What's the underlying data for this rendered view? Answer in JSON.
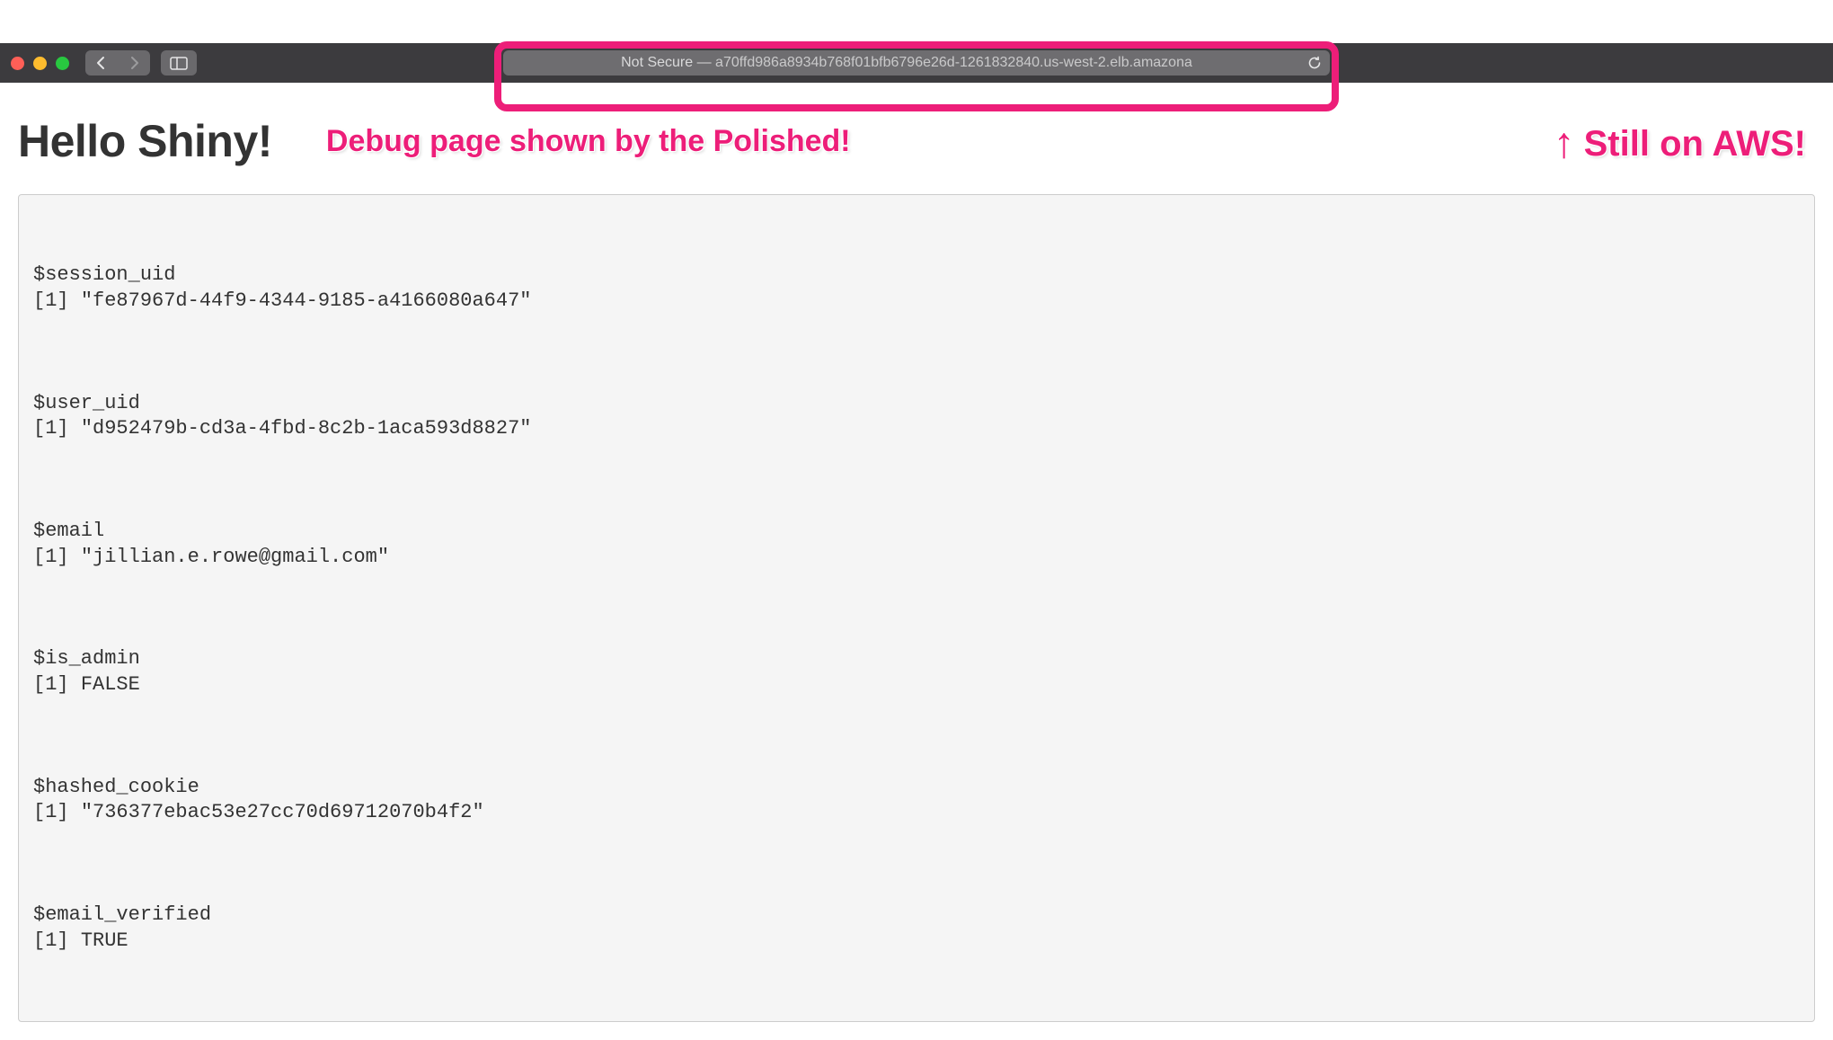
{
  "toolbar": {
    "address_prefix": "Not Secure — ",
    "address_url": "a70ffd986a8934b768f01bfb6796e26d-1261832840.us-west-2.elb.amazona"
  },
  "page": {
    "title": "Hello Shiny!"
  },
  "annotations": {
    "debug_note": "Debug page shown by the Polished!",
    "aws_note": "Still on AWS!",
    "arrow": "↑"
  },
  "debug": {
    "session_uid": {
      "label": "$session_uid",
      "index": "[1]",
      "value": "\"fe87967d-44f9-4344-9185-a4166080a647\""
    },
    "user_uid": {
      "label": "$user_uid",
      "index": "[1]",
      "value": "\"d952479b-cd3a-4fbd-8c2b-1aca593d8827\""
    },
    "email": {
      "label": "$email",
      "index": "[1]",
      "value": "\"jillian.e.rowe@gmail.com\""
    },
    "is_admin": {
      "label": "$is_admin",
      "index": "[1]",
      "value": "FALSE"
    },
    "hashed_cookie": {
      "label": "$hashed_cookie",
      "index": "[1]",
      "value": "\"736377ebac53e27cc70d69712070b4f2\""
    },
    "email_verified": {
      "label": "$email_verified",
      "index": "[1]",
      "value": "TRUE"
    }
  }
}
